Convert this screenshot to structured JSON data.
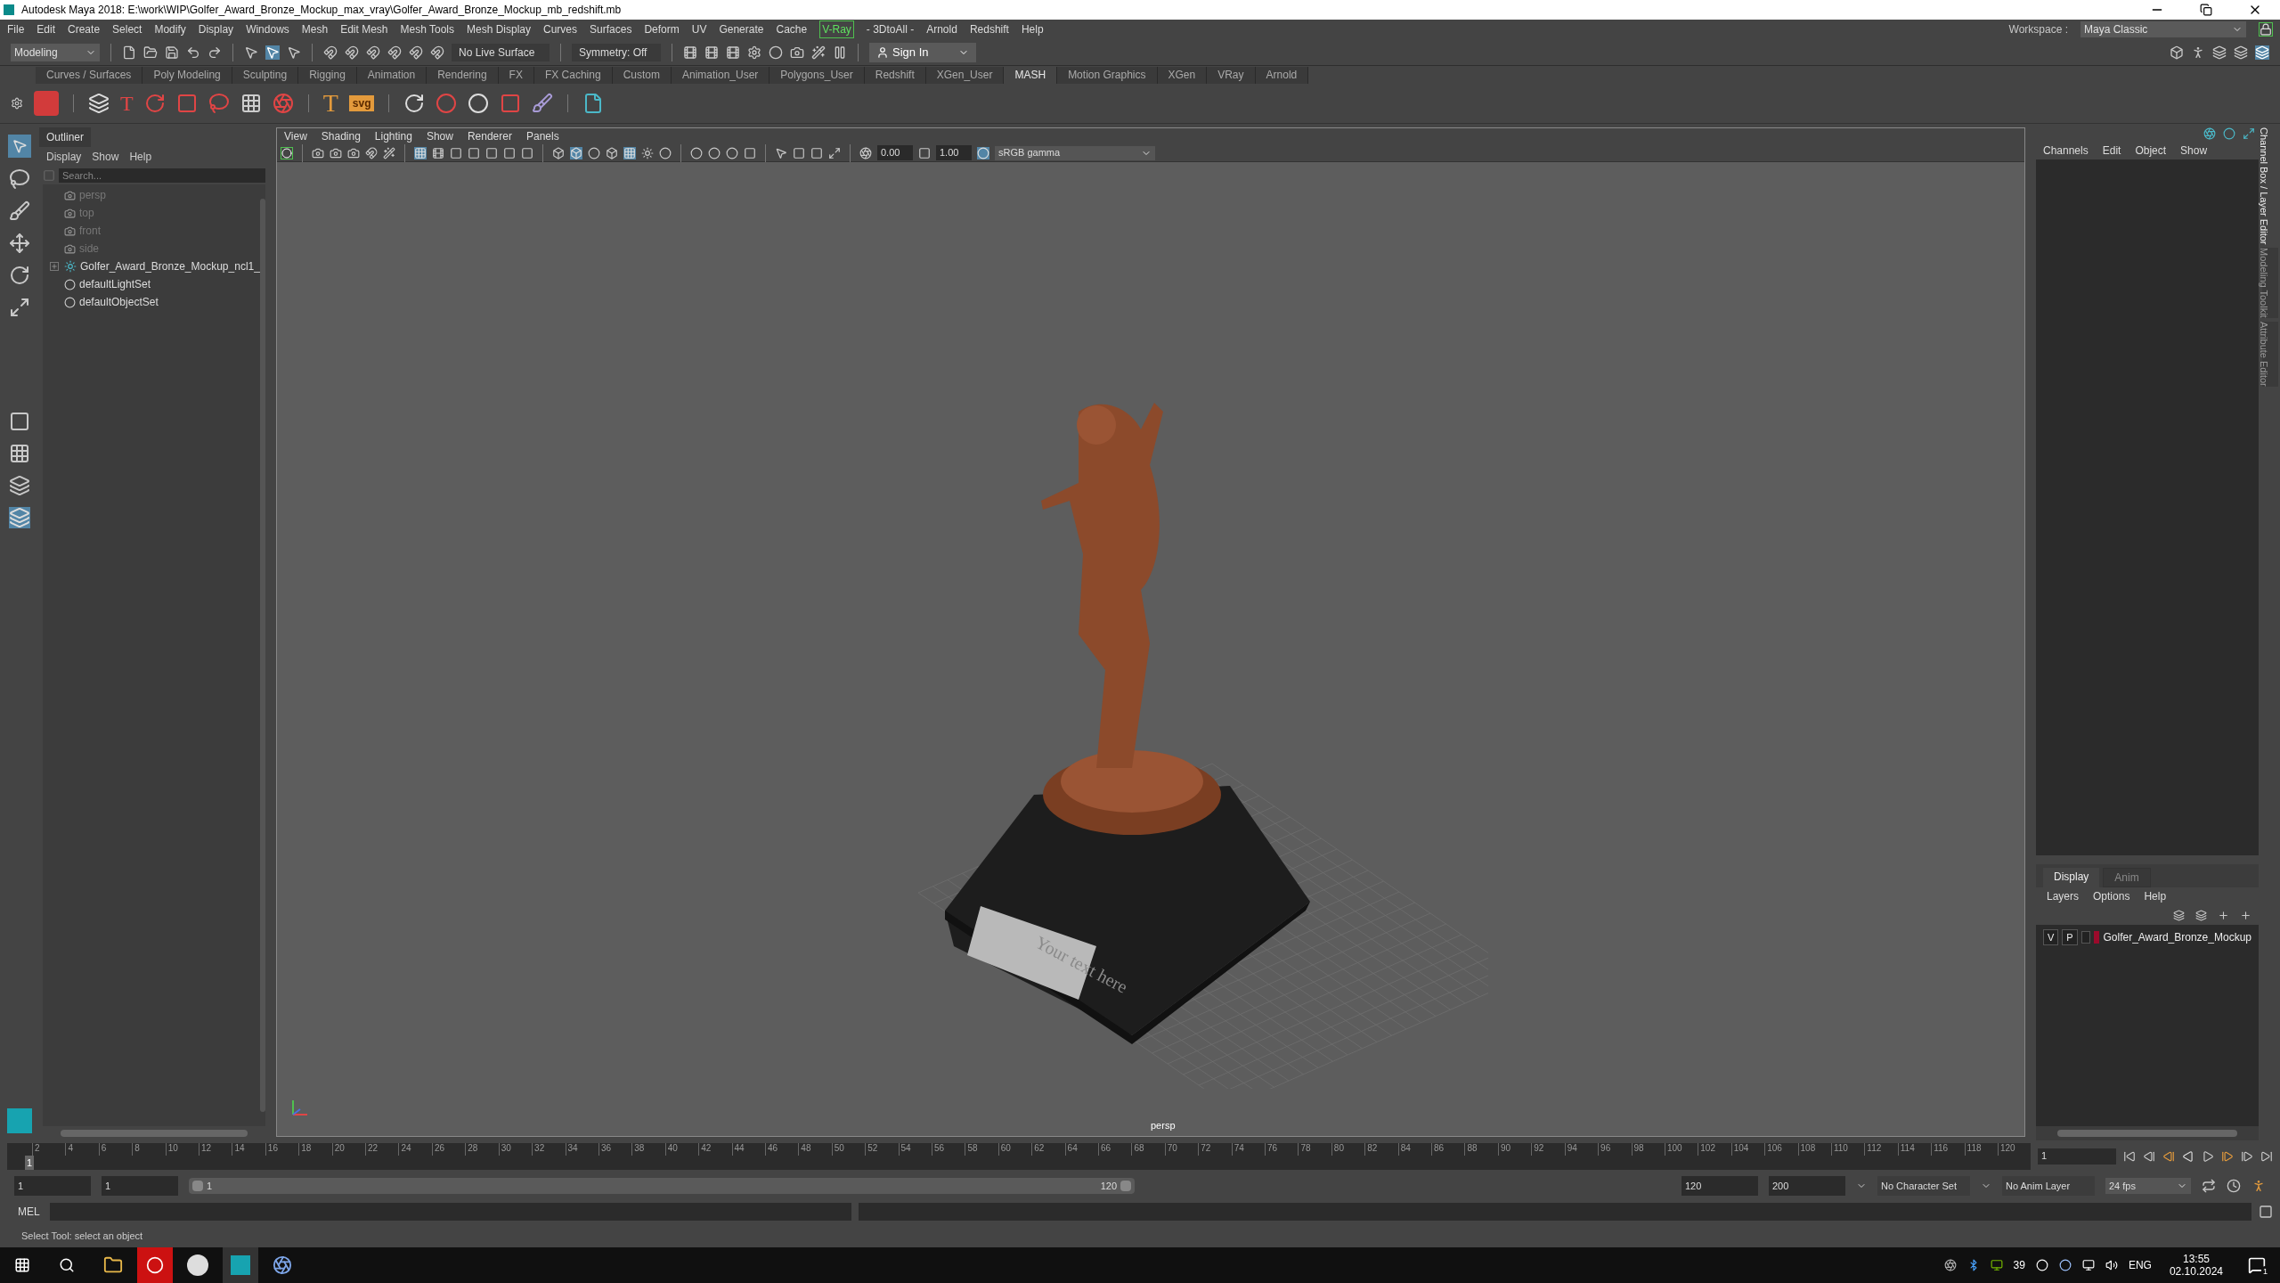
{
  "window": {
    "title": "Autodesk Maya 2018: E:\\work\\WIP\\Golfer_Award_Bronze_Mockup_max_vray\\Golfer_Award_Bronze_Mockup_mb_redshift.mb"
  },
  "menu": [
    {
      "label": "File",
      "highlighted": false
    },
    {
      "label": "Edit",
      "highlighted": false
    },
    {
      "label": "Create",
      "highlighted": false
    },
    {
      "label": "Select",
      "highlighted": false
    },
    {
      "label": "Modify",
      "highlighted": false
    },
    {
      "label": "Display",
      "highlighted": false
    },
    {
      "label": "Windows",
      "highlighted": false
    },
    {
      "label": "Mesh",
      "highlighted": false
    },
    {
      "label": "Edit Mesh",
      "highlighted": false
    },
    {
      "label": "Mesh Tools",
      "highlighted": false
    },
    {
      "label": "Mesh Display",
      "highlighted": false
    },
    {
      "label": "Curves",
      "highlighted": false
    },
    {
      "label": "Surfaces",
      "highlighted": false
    },
    {
      "label": "Deform",
      "highlighted": false
    },
    {
      "label": "UV",
      "highlighted": false
    },
    {
      "label": "Generate",
      "highlighted": false
    },
    {
      "label": "Cache",
      "highlighted": false
    },
    {
      "label": "V-Ray",
      "highlighted": true
    },
    {
      "label": "- 3DtoAll -",
      "highlighted": false
    },
    {
      "label": "Arnold",
      "highlighted": false
    },
    {
      "label": "Redshift",
      "highlighted": false
    },
    {
      "label": "Help",
      "highlighted": false
    }
  ],
  "status_line": {
    "mode": "Modeling",
    "live_surface": "No Live Surface",
    "symmetry": "Symmetry: Off",
    "sign_in": "Sign In"
  },
  "workspace": {
    "label": "Workspace :",
    "value": "Maya Classic"
  },
  "shelf": {
    "tabs": [
      {
        "label": "Curves / Surfaces",
        "selected": false
      },
      {
        "label": "Poly Modeling",
        "selected": false
      },
      {
        "label": "Sculpting",
        "selected": false
      },
      {
        "label": "Rigging",
        "selected": false
      },
      {
        "label": "Animation",
        "selected": false
      },
      {
        "label": "Rendering",
        "selected": false
      },
      {
        "label": "FX",
        "selected": false
      },
      {
        "label": "FX Caching",
        "selected": false
      },
      {
        "label": "Custom",
        "selected": false
      },
      {
        "label": "Animation_User",
        "selected": false
      },
      {
        "label": "Polygons_User",
        "selected": false
      },
      {
        "label": "Redshift",
        "selected": false
      },
      {
        "label": "XGen_User",
        "selected": false
      },
      {
        "label": "MASH",
        "selected": true
      },
      {
        "label": "Motion Graphics",
        "selected": false
      },
      {
        "label": "XGen",
        "selected": false
      },
      {
        "label": "VRay",
        "selected": false
      },
      {
        "label": "Arnold",
        "selected": false
      }
    ],
    "distribute_glyph": "T",
    "text_glyph": "T",
    "svg_glyph": "svg"
  },
  "outliner": {
    "title": "Outliner",
    "menu": [
      "Display",
      "Show",
      "Help"
    ],
    "search": {
      "placeholder": "Search..."
    },
    "items": [
      {
        "kind": "camera",
        "label": "persp",
        "dimmed": true,
        "expandable": false
      },
      {
        "kind": "camera",
        "label": "top",
        "dimmed": true,
        "expandable": false
      },
      {
        "kind": "camera",
        "label": "front",
        "dimmed": true,
        "expandable": false
      },
      {
        "kind": "camera",
        "label": "side",
        "dimmed": true,
        "expandable": false
      },
      {
        "kind": "group",
        "label": "Golfer_Award_Bronze_Mockup_ncl1_",
        "dimmed": false,
        "expandable": true
      },
      {
        "kind": "set",
        "label": "defaultLightSet",
        "dimmed": false,
        "expandable": false
      },
      {
        "kind": "set",
        "label": "defaultObjectSet",
        "dimmed": false,
        "expandable": false
      }
    ]
  },
  "viewport": {
    "menu": [
      "View",
      "Shading",
      "Lighting",
      "Show",
      "Renderer",
      "Panels"
    ],
    "exposure": "0.00",
    "gamma": "1.00",
    "color_space": "sRGB gamma",
    "plate_text": "Your text here",
    "camera_label": "persp"
  },
  "channel_box": {
    "menu": [
      "Channels",
      "Edit",
      "Object",
      "Show"
    ]
  },
  "layer_editor": {
    "tabs": [
      {
        "label": "Display",
        "selected": true
      },
      {
        "label": "Anim",
        "selected": false
      }
    ],
    "menu": [
      "Layers",
      "Options",
      "Help"
    ],
    "layers": [
      {
        "visible": "V",
        "playback": "P",
        "color": "#9b0a2b",
        "name": "Golfer_Award_Bronze_Mockup"
      }
    ]
  },
  "side_tabs": [
    {
      "label": "Channel Box / Layer Editor",
      "selected": true
    },
    {
      "label": "Modeling Toolkit",
      "selected": false
    },
    {
      "label": "Attribute Editor",
      "selected": false
    }
  ],
  "timeline": {
    "level": 0,
    "current": "1",
    "ticks": [
      "2",
      "4",
      "6",
      "8",
      "10",
      "12",
      "14",
      "16",
      "18",
      "20",
      "22",
      "24",
      "26",
      "28",
      "30",
      "32",
      "34",
      "36",
      "38",
      "40",
      "42",
      "44",
      "46",
      "48",
      "50",
      "52",
      "54",
      "56",
      "58",
      "60",
      "62",
      "64",
      "66",
      "68",
      "70",
      "72",
      "74",
      "76",
      "78",
      "80",
      "82",
      "84",
      "86",
      "88",
      "90",
      "92",
      "94",
      "96",
      "98",
      "100",
      "102",
      "104",
      "106",
      "108",
      "110",
      "112",
      "114",
      "116",
      "118",
      "120"
    ],
    "frame_field": "1"
  },
  "range": {
    "level": 1,
    "start": "1",
    "playback_start": "1",
    "slider_start": "1",
    "slider_end": "120",
    "playback_end": "120",
    "end": "200",
    "character_set": "No Character Set",
    "anim_layer": "No Anim Layer",
    "fps": "24 fps"
  },
  "command_line": {
    "label": "MEL"
  },
  "help_line": "Select Tool: select an object",
  "taskbar": {
    "temperature": "39",
    "language": "ENG",
    "time": "13:55",
    "date": "02.10.2024",
    "notifications": "1"
  }
}
